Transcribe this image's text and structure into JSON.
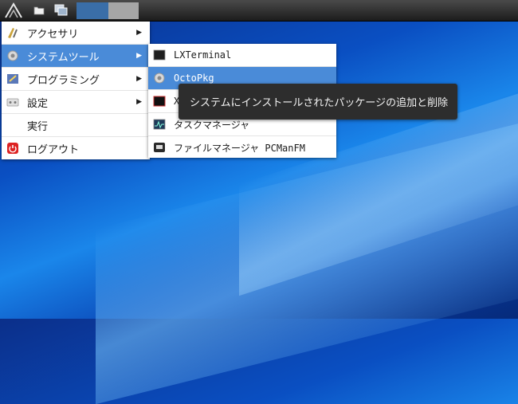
{
  "colors": {
    "menu_highlight": "#4a8bd8",
    "panel": "#2a2a2a",
    "tooltip_bg": "#2d2d2d",
    "task_active": "#3a6ea8",
    "task_inactive": "#a6a6a6"
  },
  "panel": {
    "start_icon": "lxqt-logo-icon",
    "buttons": [
      "folder-icon",
      "show-desktop-icon"
    ]
  },
  "main_menu": {
    "items": [
      {
        "label": "アクセサリ",
        "icon": "accessories-icon",
        "has_submenu": true
      },
      {
        "label": "システムツール",
        "icon": "system-tools-icon",
        "has_submenu": true,
        "active": true
      },
      {
        "label": "プログラミング",
        "icon": "programming-icon",
        "has_submenu": true
      },
      {
        "label": "設定",
        "icon": "settings-icon",
        "has_submenu": true
      },
      {
        "label": "実行",
        "icon": "",
        "has_submenu": false
      },
      {
        "label": "ログアウト",
        "icon": "logout-icon",
        "has_submenu": false
      }
    ]
  },
  "sub_menu": {
    "items": [
      {
        "label": "LXTerminal",
        "icon": "terminal-icon"
      },
      {
        "label": "OctoPkg",
        "icon": "octopkg-icon",
        "active": true
      },
      {
        "label": "X",
        "icon": "xterm-icon"
      },
      {
        "label": "タスクマネージャ",
        "icon": "task-manager-icon"
      },
      {
        "label": "ファイルマネージャ PCManFM",
        "icon": "file-manager-icon"
      }
    ]
  },
  "tooltip": {
    "text": "システムにインストールされたパッケージの追加と削除"
  }
}
